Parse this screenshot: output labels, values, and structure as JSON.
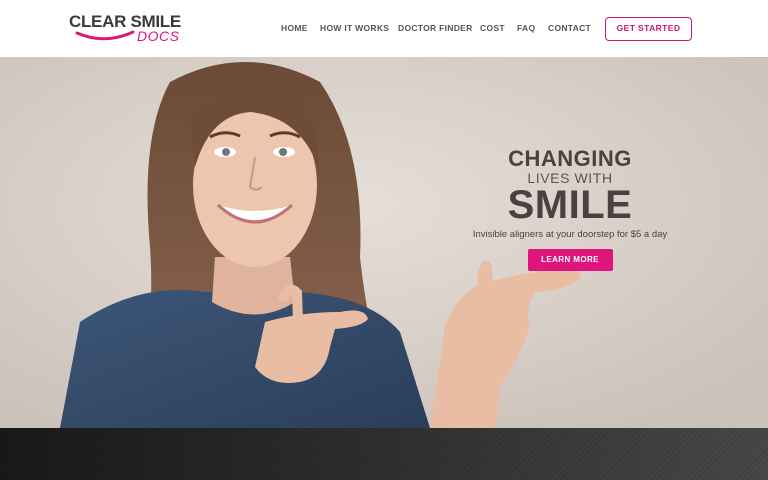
{
  "brand": {
    "logo_top": "CLEAR SMILE",
    "logo_bottom": "DOCS",
    "accent": "#e0147d",
    "dark_text": "#4a4240"
  },
  "nav": {
    "items": [
      {
        "label": "HOME"
      },
      {
        "label": "HOW IT WORKS"
      },
      {
        "label": "DOCTOR FINDER"
      },
      {
        "label": "COST"
      },
      {
        "label": "FAQ"
      },
      {
        "label": "CONTACT"
      }
    ],
    "cta_label": "GET STARTED"
  },
  "hero": {
    "line1": "CHANGING",
    "line2": "LIVES WITH",
    "line3": "SMILE",
    "subtitle": "Invisible aligners at your doorstep for $5 a day",
    "button_label": "LEARN MORE"
  }
}
